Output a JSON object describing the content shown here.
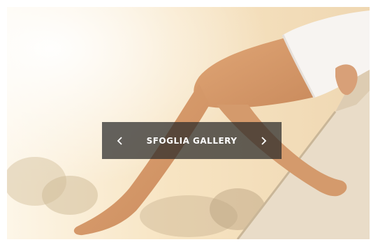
{
  "gallery": {
    "label": "SFOGLIA GALLERY",
    "prev_icon": "chevron-left-icon",
    "next_icon": "chevron-right-icon",
    "overlay_color": "#282828"
  },
  "photo": {
    "subject": "legs-on-wall-photo",
    "background_color": "#f6e6c6"
  }
}
